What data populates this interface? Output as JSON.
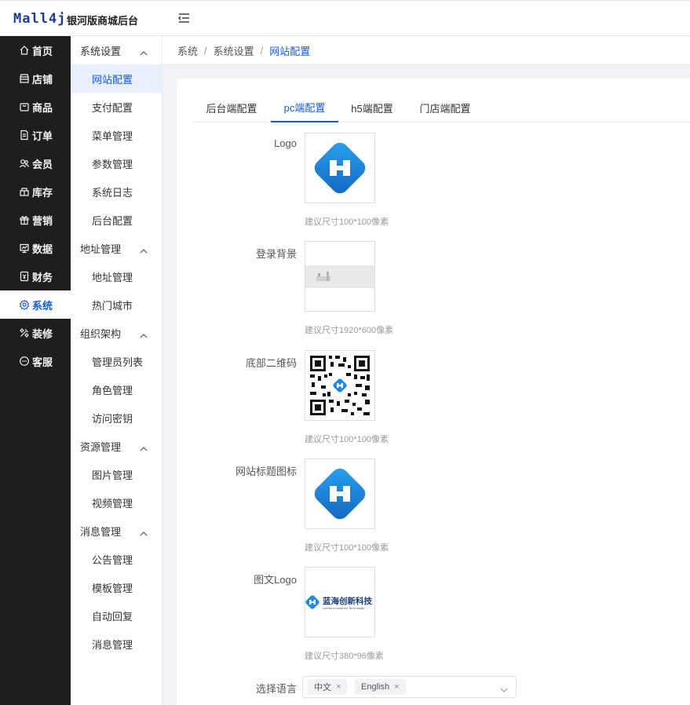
{
  "header": {
    "logo_text": "Mall4j",
    "app_title": "银河版商城后台",
    "collapse_icon": "fold-menu-icon"
  },
  "sidebar": {
    "items": [
      {
        "label": "首页",
        "icon": "home-icon"
      },
      {
        "label": "店铺",
        "icon": "shop-icon"
      },
      {
        "label": "商品",
        "icon": "goods-icon"
      },
      {
        "label": "订单",
        "icon": "order-icon"
      },
      {
        "label": "会员",
        "icon": "member-icon"
      },
      {
        "label": "库存",
        "icon": "stock-icon"
      },
      {
        "label": "营销",
        "icon": "gift-icon"
      },
      {
        "label": "数据",
        "icon": "chart-icon"
      },
      {
        "label": "财务",
        "icon": "finance-icon"
      },
      {
        "label": "系统",
        "icon": "gear-icon",
        "active": true
      },
      {
        "label": "装修",
        "icon": "decorate-icon"
      },
      {
        "label": "客服",
        "icon": "chat-icon"
      }
    ]
  },
  "submenu": {
    "groups": [
      {
        "title": "系统设置",
        "items": [
          "网站配置",
          "支付配置",
          "菜单管理",
          "参数管理",
          "系统日志",
          "后台配置"
        ]
      },
      {
        "title": "地址管理",
        "items": [
          "地址管理",
          "热门城市"
        ]
      },
      {
        "title": "组织架构",
        "items": [
          "管理员列表",
          "角色管理",
          "访问密钥"
        ]
      },
      {
        "title": "资源管理",
        "items": [
          "图片管理",
          "视频管理"
        ]
      },
      {
        "title": "消息管理",
        "items": [
          "公告管理",
          "模板管理",
          "自动回复",
          "消息管理"
        ]
      }
    ],
    "active_item": "网站配置"
  },
  "breadcrumb": {
    "items": [
      "系统",
      "系统设置",
      "网站配置"
    ],
    "separator": "/"
  },
  "tabs": [
    "后台端配置",
    "pc端配置",
    "h5端配置",
    "门店端配置"
  ],
  "active_tab": "pc端配置",
  "form": {
    "fields": [
      {
        "label": "Logo",
        "hint": "建议尺寸100*100像素",
        "image": "brand-logo-image"
      },
      {
        "label": "登录背景",
        "hint": "建议尺寸1920*600像素",
        "image": "login-background-image"
      },
      {
        "label": "底部二维码",
        "hint": "建议尺寸100*100像素",
        "image": "qr-code-image"
      },
      {
        "label": "网站标题图标",
        "hint": "建议尺寸100*100像素",
        "image": "favicon-image"
      },
      {
        "label": "图文Logo",
        "hint": "建议尺寸380*96像素",
        "image": "text-logo-image",
        "logo_text": "蓝海创新科技",
        "logo_subtext": "Lanhai Innovation Technology"
      }
    ],
    "language": {
      "label": "选择语言",
      "selected": [
        "中文",
        "English"
      ],
      "remove_symbol": "×"
    }
  },
  "colors": {
    "accent": "#155bd4",
    "sidebar_bg": "#1d1e1f",
    "submenu_active_bg": "#e8efff",
    "logo_blue": "#1e88e5"
  }
}
